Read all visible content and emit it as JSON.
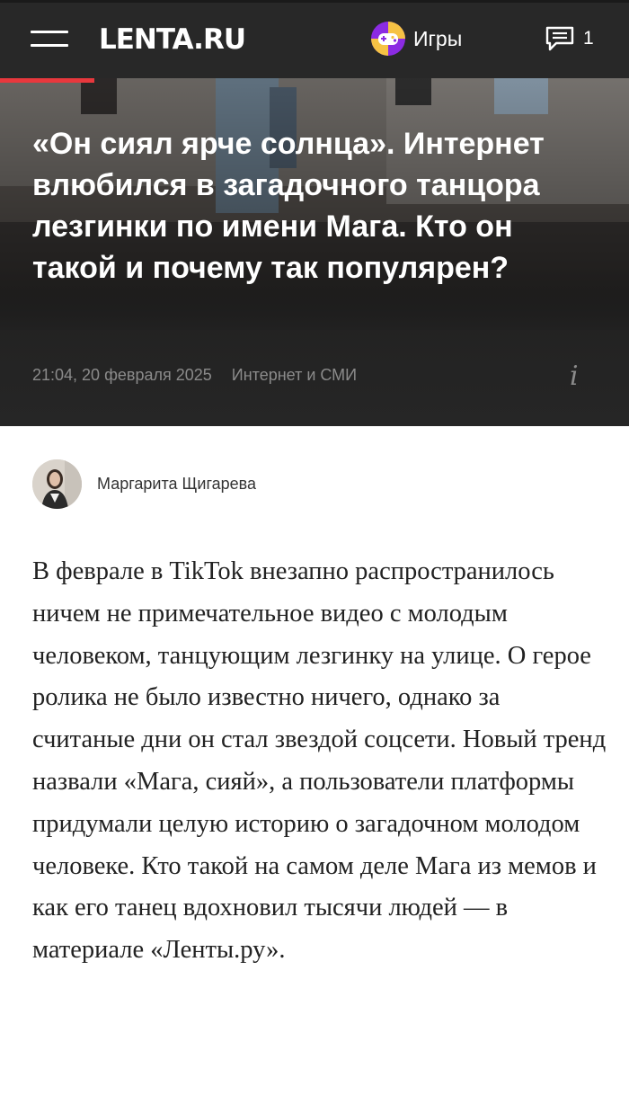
{
  "header": {
    "logo_text": "LENTA.RU",
    "games_label": "Игры",
    "comments_count": "1",
    "menu_icon": "hamburger-icon",
    "games_icon": "gamepad-icon",
    "comments_icon": "comment-icon"
  },
  "article": {
    "title": "«Он сиял ярче солнца». Интернет влюбился в загадочного танцора лезгинки по имени Мага. Кто он такой и почему так популярен?",
    "datetime": "21:04, 20 февраля 2025",
    "rubric": "Интернет и СМИ",
    "info_label": "i",
    "author_name": "Маргарита Щигарева",
    "lead": "В феврале в TikTok внезапно распространилось ничем не примечательное видео с молодым человеком, танцующим лезгинку на улице. О герое ролика не было известно ничего, однако за считаные дни он стал звездой соцсети. Новый тренд назвали «Мага, сияй», а пользователи платформы придумали целую историю о загадочном молодом человеке. Кто такой на самом деле Мага из мемов и как его танец вдохновил тысячи людей — в материале «Ленты.ру»."
  },
  "colors": {
    "header_bg": "#282828",
    "accent_red": "#e8383d",
    "meta_gray": "#8b8b8b",
    "games_icon_purple": "#8b2be2",
    "games_icon_yellow": "#f6c244"
  }
}
